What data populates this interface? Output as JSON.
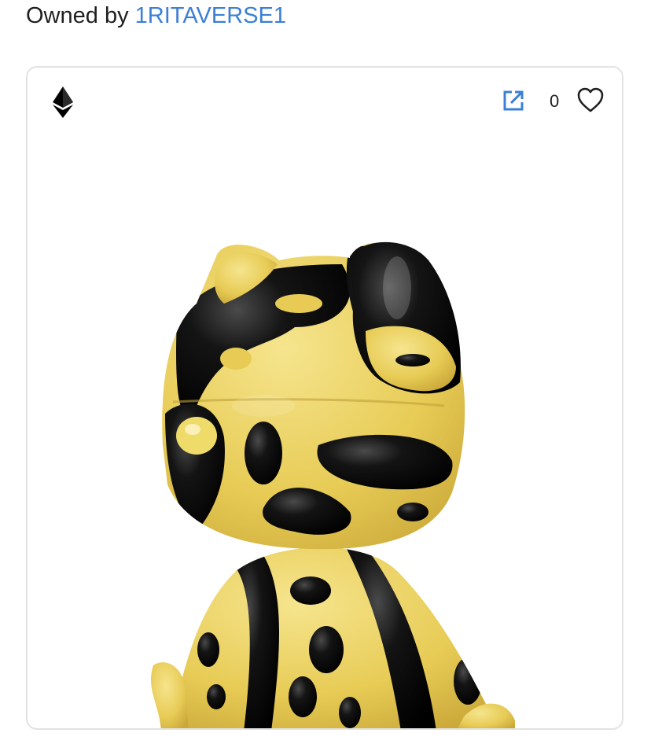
{
  "owner": {
    "prefix": "Owned by",
    "name": "1RITAVERSE1"
  },
  "card": {
    "chain_icon": "ethereum-icon",
    "external_icon": "external-link-icon",
    "like_count": "0",
    "like_icon": "heart-outline-icon"
  },
  "colors": {
    "link": "#3b7fd6",
    "border": "#e3e3e3",
    "figure_yellow": "#e9cf5a",
    "figure_black": "#0d0d0d"
  }
}
